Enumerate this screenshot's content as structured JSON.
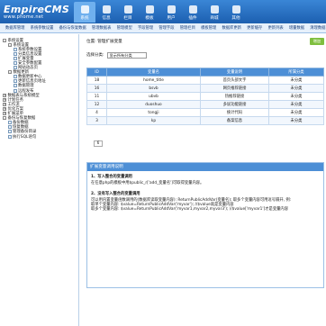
{
  "app": {
    "logo": "EmpireCMS",
    "logo_sub": "www.phome.net"
  },
  "topnav": [
    {
      "label": "系统",
      "icon": "system-icon",
      "active": true
    },
    {
      "label": "信息",
      "icon": "info-icon"
    },
    {
      "label": "栏目",
      "icon": "column-icon"
    },
    {
      "label": "模板",
      "icon": "template-icon"
    },
    {
      "label": "用户",
      "icon": "user-icon"
    },
    {
      "label": "插件",
      "icon": "plugin-icon"
    },
    {
      "label": "商城",
      "icon": "shop-icon"
    },
    {
      "label": "其他",
      "icon": "other-icon"
    }
  ],
  "subbar": [
    "数据库管理",
    "系统参数设置",
    "备份与恢复数据",
    "管理数据表",
    "管理模型",
    "字段管理",
    "管理字段",
    "管理栏目",
    "模板管理",
    "数据库更新",
    "更新缓存",
    "更新列表",
    "增量数据",
    "清理数据",
    "同步数据"
  ],
  "sidebar": [
    {
      "label": "系统设置",
      "level": 0,
      "fold": "-"
    },
    {
      "label": "系统设置",
      "level": 1,
      "fold": "-"
    },
    {
      "label": "系统参数设置",
      "level": 2
    },
    {
      "label": "分类信息设置",
      "level": 2
    },
    {
      "label": "扩展变量",
      "level": 2
    },
    {
      "label": "安全参数配置",
      "level": 2
    },
    {
      "label": "网站动态页",
      "level": 2
    },
    {
      "label": "数据更新",
      "level": 1,
      "fold": "-"
    },
    {
      "label": "数据更新中心",
      "level": 2
    },
    {
      "label": "更新信息页地址",
      "level": 2
    },
    {
      "label": "数据管理",
      "level": 2
    },
    {
      "label": "远程发布",
      "level": 2
    },
    {
      "label": "数据表与系统模型",
      "level": 0,
      "fold": "+"
    },
    {
      "label": "计划任务",
      "level": 0,
      "fold": "+"
    },
    {
      "label": "工作流",
      "level": 0,
      "fold": "+"
    },
    {
      "label": "优化方案",
      "level": 0,
      "fold": "+"
    },
    {
      "label": "扩展菜单",
      "level": 0,
      "fold": "+"
    },
    {
      "label": "备份与恢复数据",
      "level": 0,
      "fold": "-"
    },
    {
      "label": "备份数据",
      "level": 1
    },
    {
      "label": "恢复数据",
      "level": 1
    },
    {
      "label": "管理备份目录",
      "level": 1
    },
    {
      "label": "执行SQL语句",
      "level": 1
    }
  ],
  "main": {
    "breadcrumb": "位置: 管理扩展变量",
    "add_button": "增加",
    "filter_label": "选择分类:",
    "filter_value": "显示所有分类",
    "table_headers": [
      "ID",
      "变量名",
      "变量说明",
      "所属分类"
    ],
    "rows": [
      {
        "id": "18",
        "name": "home_title",
        "desc": "首页头部文字",
        "cat": "未分类"
      },
      {
        "id": "16",
        "name": "bsvb",
        "desc": "网页推荐链接",
        "cat": "未分类"
      },
      {
        "id": "11",
        "name": "ubvb",
        "desc": "热推荐链接",
        "cat": "未分类"
      },
      {
        "id": "12",
        "name": "duoshuo",
        "desc": "多说功能链接",
        "cat": "未分类"
      },
      {
        "id": "4",
        "name": "tongji",
        "desc": "统计代码",
        "cat": "未分类"
      },
      {
        "id": "3",
        "name": "kp",
        "desc": "备案信息",
        "cat": "未分类"
      }
    ],
    "page": "6"
  },
  "explain": {
    "title": "扩展变量调用说明",
    "s1_title": "1、写入整合的变量调用",
    "s1_text": "在任意php的模板中用$public_r['add_变量名']可取得变量内容。",
    "s2_title": "2、没有写入整合的变量调用",
    "s2_line1": "可以用内置变量函数调用的(数据库读取变量内容): ReturnPublicAddVar(变量名); 取多个变量内容可用逗号隔开, 例:",
    "s2_line2": "取单个变量内容: $value=ReturnPublicAddVar('myvar'); //$value就是变量内容",
    "s2_line3": "取多个变量内容: $value=ReturnPublicAddVar('myvar1,myvar2,myvar3'); //$value['myvar1']才是变量内容"
  }
}
